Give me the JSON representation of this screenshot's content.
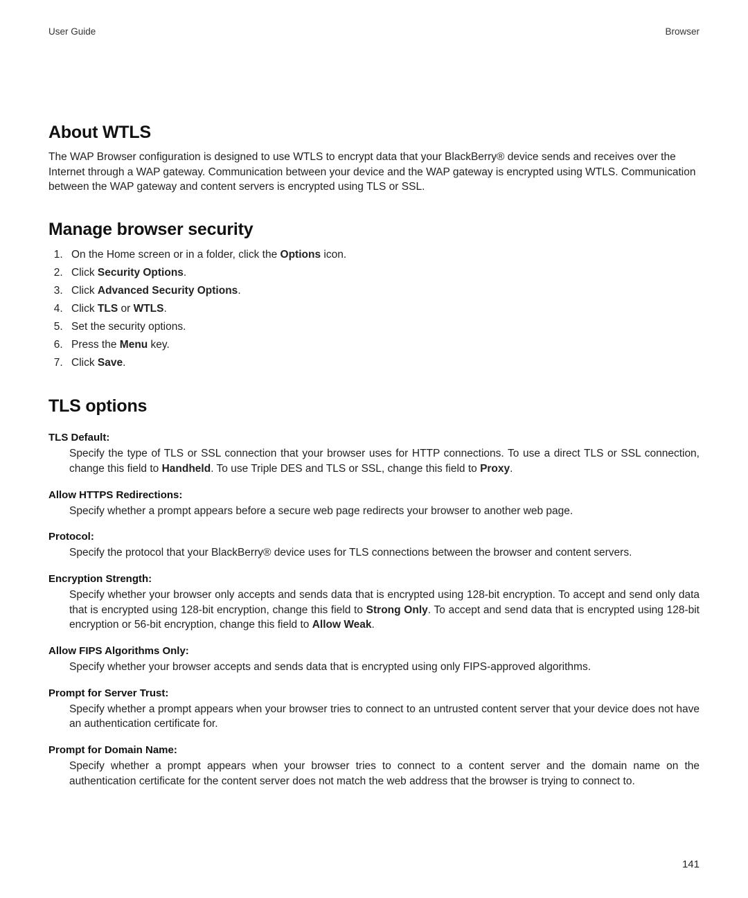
{
  "header": {
    "left": "User Guide",
    "right": "Browser"
  },
  "section1": {
    "title": "About WTLS",
    "body": "The WAP Browser configuration is designed to use WTLS to encrypt data that your BlackBerry® device sends and receives over the Internet through a WAP gateway. Communication between your device and the WAP gateway is encrypted using WTLS. Communication between the WAP gateway and content servers is encrypted using TLS or SSL."
  },
  "section2": {
    "title": "Manage browser security",
    "steps": [
      {
        "pre": "On the Home screen or in a folder, click the ",
        "bold": "Options",
        "post": " icon."
      },
      {
        "pre": "Click ",
        "bold": "Security Options",
        "post": "."
      },
      {
        "pre": "Click ",
        "bold": "Advanced Security Options",
        "post": "."
      },
      {
        "pre": "Click ",
        "bold": "TLS",
        "mid": " or ",
        "bold2": "WTLS",
        "post": "."
      },
      {
        "pre": "Set the security options.",
        "bold": "",
        "post": ""
      },
      {
        "pre": "Press the ",
        "bold": "Menu",
        "post": " key."
      },
      {
        "pre": "Click ",
        "bold": "Save",
        "post": "."
      }
    ]
  },
  "section3": {
    "title": "TLS options",
    "items": [
      {
        "term": "TLS Default:",
        "descParts": [
          {
            "t": "Specify the type of TLS or SSL connection that your browser uses for HTTP connections. To use a direct TLS or SSL connection, change this field to "
          },
          {
            "b": "Handheld"
          },
          {
            "t": ". To use Triple DES and TLS or SSL, change this field to "
          },
          {
            "b": "Proxy"
          },
          {
            "t": "."
          }
        ]
      },
      {
        "term": "Allow HTTPS Redirections:",
        "descParts": [
          {
            "t": "Specify whether a prompt appears before a secure web page redirects your browser to another web page."
          }
        ]
      },
      {
        "term": "Protocol:",
        "descParts": [
          {
            "t": "Specify the protocol that your BlackBerry® device uses for TLS connections between the browser and content servers."
          }
        ]
      },
      {
        "term": "Encryption Strength:",
        "descParts": [
          {
            "t": "Specify whether your browser only accepts and sends data that is encrypted using 128-bit encryption. To accept and send only data that is encrypted using 128-bit encryption, change this field to "
          },
          {
            "b": "Strong Only"
          },
          {
            "t": ". To accept and send data that is encrypted using 128-bit encryption or 56-bit encryption, change this field to "
          },
          {
            "b": "Allow Weak"
          },
          {
            "t": "."
          }
        ]
      },
      {
        "term": "Allow FIPS Algorithms Only:",
        "descParts": [
          {
            "t": "Specify whether your browser accepts and sends data that is encrypted using only FIPS-approved algorithms."
          }
        ]
      },
      {
        "term": "Prompt for Server Trust:",
        "descParts": [
          {
            "t": "Specify whether a prompt appears when your browser tries to connect to an untrusted content server that your device does not have an authentication certificate for."
          }
        ]
      },
      {
        "term": "Prompt for Domain Name:",
        "descParts": [
          {
            "t": "Specify whether a prompt appears when your browser tries to connect to a content server and the domain name on the authentication certificate for the content server does not match the web address that the browser is trying to connect to."
          }
        ]
      }
    ]
  },
  "pagenum": "141"
}
